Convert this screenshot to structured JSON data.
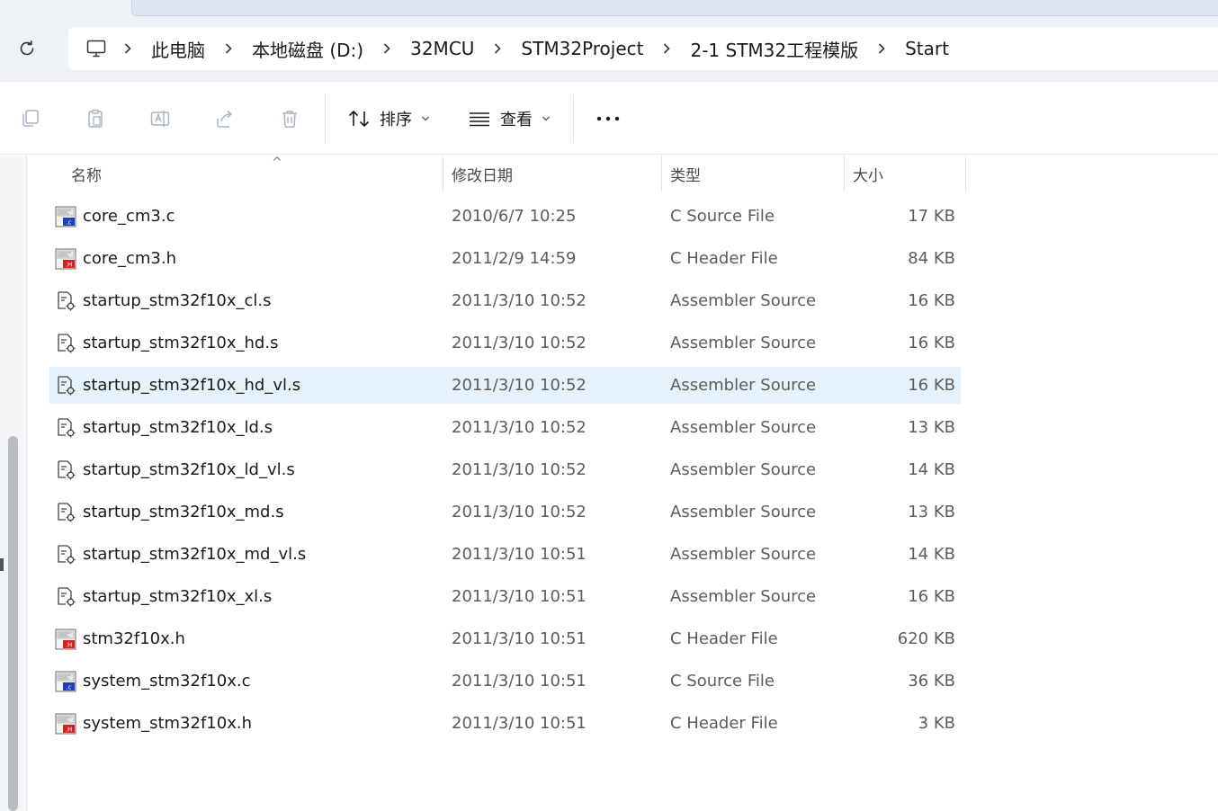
{
  "breadcrumb": {
    "items": [
      "此电脑",
      "本地磁盘 (D:)",
      "32MCU",
      "STM32Project",
      "2-1 STM32工程模版",
      "Start"
    ]
  },
  "toolbar": {
    "sort_label": "排序",
    "view_label": "查看"
  },
  "columns": {
    "name": "名称",
    "date": "修改日期",
    "type": "类型",
    "size": "大小"
  },
  "files": [
    {
      "name": "core_cm3.c",
      "date": "2010/6/7 10:25",
      "type": "C Source File",
      "size": "17 KB",
      "icon": "c-source-file-icon",
      "selected": false
    },
    {
      "name": "core_cm3.h",
      "date": "2011/2/9 14:59",
      "type": "C Header File",
      "size": "84 KB",
      "icon": "c-header-file-icon",
      "selected": false
    },
    {
      "name": "startup_stm32f10x_cl.s",
      "date": "2011/3/10 10:52",
      "type": "Assembler Source",
      "size": "16 KB",
      "icon": "assembler-file-icon",
      "selected": false
    },
    {
      "name": "startup_stm32f10x_hd.s",
      "date": "2011/3/10 10:52",
      "type": "Assembler Source",
      "size": "16 KB",
      "icon": "assembler-file-icon",
      "selected": false
    },
    {
      "name": "startup_stm32f10x_hd_vl.s",
      "date": "2011/3/10 10:52",
      "type": "Assembler Source",
      "size": "16 KB",
      "icon": "assembler-file-icon",
      "selected": true
    },
    {
      "name": "startup_stm32f10x_ld.s",
      "date": "2011/3/10 10:52",
      "type": "Assembler Source",
      "size": "13 KB",
      "icon": "assembler-file-icon",
      "selected": false
    },
    {
      "name": "startup_stm32f10x_ld_vl.s",
      "date": "2011/3/10 10:52",
      "type": "Assembler Source",
      "size": "14 KB",
      "icon": "assembler-file-icon",
      "selected": false
    },
    {
      "name": "startup_stm32f10x_md.s",
      "date": "2011/3/10 10:52",
      "type": "Assembler Source",
      "size": "13 KB",
      "icon": "assembler-file-icon",
      "selected": false
    },
    {
      "name": "startup_stm32f10x_md_vl.s",
      "date": "2011/3/10 10:51",
      "type": "Assembler Source",
      "size": "14 KB",
      "icon": "assembler-file-icon",
      "selected": false
    },
    {
      "name": "startup_stm32f10x_xl.s",
      "date": "2011/3/10 10:51",
      "type": "Assembler Source",
      "size": "16 KB",
      "icon": "assembler-file-icon",
      "selected": false
    },
    {
      "name": "stm32f10x.h",
      "date": "2011/3/10 10:51",
      "type": "C Header File",
      "size": "620 KB",
      "icon": "c-header-file-icon",
      "selected": false
    },
    {
      "name": "system_stm32f10x.c",
      "date": "2011/3/10 10:51",
      "type": "C Source File",
      "size": "36 KB",
      "icon": "c-source-file-icon",
      "selected": false
    },
    {
      "name": "system_stm32f10x.h",
      "date": "2011/3/10 10:51",
      "type": "C Header File",
      "size": "3 KB",
      "icon": "c-header-file-icon",
      "selected": false
    }
  ],
  "colors": {
    "selection": "#e5f1fb",
    "c_source_badge": "#1f3fbf",
    "c_header_badge": "#d42020",
    "toolbar_disabled": "#a9b4c2"
  }
}
